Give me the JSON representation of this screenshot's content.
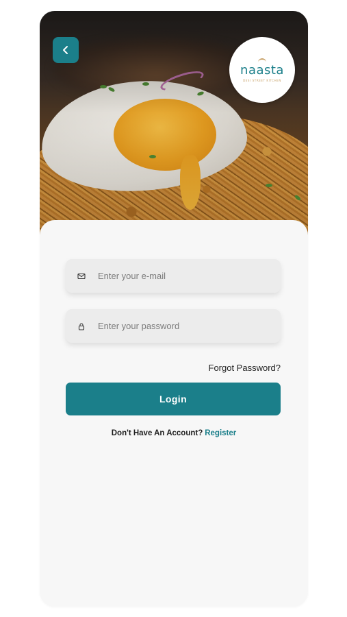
{
  "header": {
    "back_icon": "chevron-left-icon",
    "logo": {
      "name": "naasta",
      "tagline": "DESI STREET KITCHEN"
    }
  },
  "form": {
    "email": {
      "icon": "mail-icon",
      "placeholder": "Enter your e-mail",
      "value": ""
    },
    "password": {
      "icon": "lock-icon",
      "placeholder": "Enter your password",
      "value": ""
    },
    "forgot_label": "Forgot Password?",
    "login_label": "Login",
    "no_account_text": "Don't Have An Account?",
    "register_label": "Register"
  },
  "colors": {
    "accent": "#1b7f8a",
    "card_background": "#f7f7f7",
    "field_background": "#ececec",
    "logo_gold": "#c9a36b"
  }
}
